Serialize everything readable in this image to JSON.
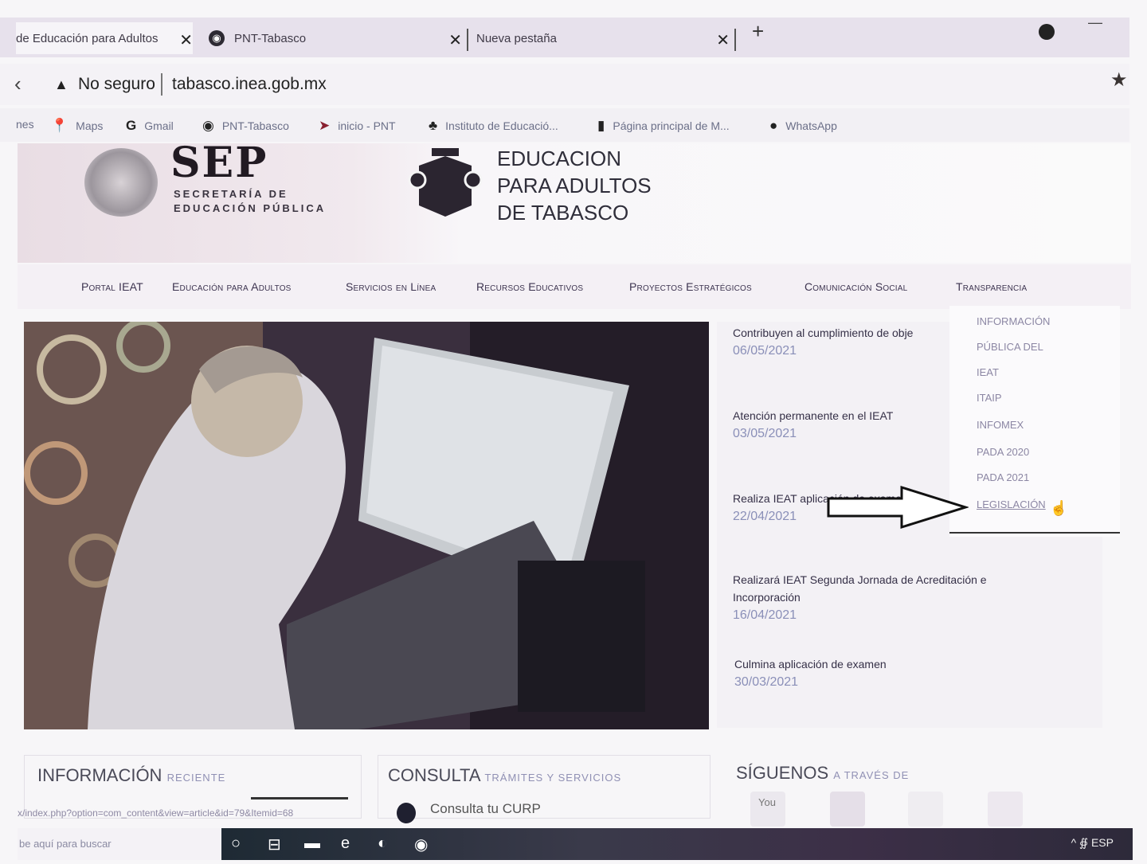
{
  "browser": {
    "tabs": [
      {
        "label": "de Educación para Adultos"
      },
      {
        "label": "PNT-Tabasco"
      },
      {
        "label": "Nueva pestaña"
      }
    ],
    "new_tab": "+",
    "security_label": "No seguro",
    "url": "tabasco.inea.gob.mx",
    "bookmarks": [
      {
        "label": "nes",
        "icon": "bookmark-icon"
      },
      {
        "label": "Maps",
        "icon": "map-pin-icon"
      },
      {
        "label": "Gmail",
        "icon": "google-icon"
      },
      {
        "label": "PNT-Tabasco",
        "icon": "globe-icon"
      },
      {
        "label": "inicio - PNT",
        "icon": "pnt-icon"
      },
      {
        "label": "Instituto de Educació...",
        "icon": "institute-icon"
      },
      {
        "label": "Página principal de M...",
        "icon": "office-icon"
      },
      {
        "label": "WhatsApp",
        "icon": "whatsapp-icon"
      }
    ]
  },
  "site": {
    "sep_logo": "SEP",
    "sep_sub1": "SECRETARÍA DE",
    "sep_sub2": "EDUCACIÓN PÚBLICA",
    "ieat_line1": "EDUCACION",
    "ieat_line2": "PARA ADULTOS",
    "ieat_line3": "DE TABASCO",
    "nav": [
      "Portal IEAT",
      "Educación para Adultos",
      "Servicios en Línea",
      "Recursos Educativos",
      "Proyectos Estratégicos",
      "Comunicación Social",
      "Transparencia"
    ],
    "dropdown": [
      "INFORMACIÓN",
      "PÚBLICA DEL",
      "IEAT",
      "ITAIP",
      "INFOMEX",
      "PADA 2020",
      "PADA 2021",
      "LEGISLACIÓN"
    ],
    "news": [
      {
        "title": "Contribuyen al cumplimiento de obje",
        "date": "06/05/2021"
      },
      {
        "title": "Atención permanente en el IEAT",
        "date": "03/05/2021"
      },
      {
        "title": "Realiza IEAT aplicación de examenes",
        "date": "22/04/2021"
      },
      {
        "title": "Realizará IEAT Segunda Jornada de Acreditación e",
        "title2": "Incorporación",
        "date": "16/04/2021"
      },
      {
        "title": "Culmina aplicación de examen",
        "date": "30/03/2021"
      }
    ],
    "panels": {
      "info_main": "INFORMACIÓN",
      "info_sub": "RECIENTE",
      "consulta_main": "CONSULTA",
      "consulta_sub": "TRÁMITES Y SERVICIOS",
      "siguenos_main": "SÍGUENOS",
      "siguenos_sub": "A TRAVÉS DE",
      "curp_link": "Consulta tu CURP"
    },
    "social": [
      "youtube-icon",
      "facebook-icon",
      "flickr-icon",
      "instagram-icon"
    ],
    "youtube_text": "You"
  },
  "status_url": "x/index.php?option=com_content&view=article&id=79&Itemid=68",
  "taskbar": {
    "search_placeholder": "be aquí para buscar",
    "tray": "^ ∯  ESP"
  },
  "colors": {
    "nav_text": "#3d3450",
    "dropdown_text": "#8c87a4",
    "date_text": "#8a8fb8"
  }
}
